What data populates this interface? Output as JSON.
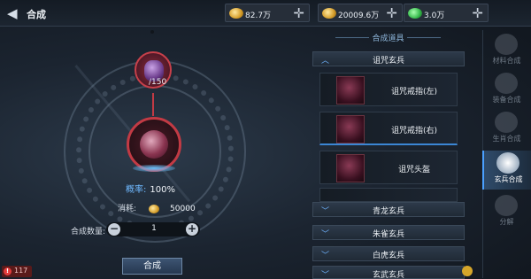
{
  "header": {
    "title": "合成",
    "currencies": [
      {
        "icon": "gold-ingot-icon",
        "value": "82.7万"
      },
      {
        "icon": "gold-ingot-icon",
        "value": "20009.6万"
      },
      {
        "icon": "jade-gem-icon",
        "value": "3.0万"
      }
    ]
  },
  "synth": {
    "material_count": "/150",
    "rate_label": "概率:",
    "rate_value": "100%",
    "cost_label": "消耗:",
    "cost_value": "50000",
    "qty_label": "合成数量:",
    "qty_value": "1",
    "combine_label": "合成"
  },
  "notification_count": "117",
  "panel": {
    "title": "合成道具",
    "expanded_category": "诅咒玄兵",
    "items": [
      {
        "name": "诅咒戒指(左)"
      },
      {
        "name": "诅咒戒指(右)"
      },
      {
        "name": "诅咒头盔"
      }
    ],
    "collapsed_categories": [
      "青龙玄兵",
      "朱雀玄兵",
      "白虎玄兵",
      "玄武玄兵"
    ]
  },
  "tabs": [
    {
      "label": "材料合成",
      "icon": "materials-icon",
      "active": false
    },
    {
      "label": "装备合成",
      "icon": "equipment-icon",
      "active": false
    },
    {
      "label": "生肖合成",
      "icon": "zodiac-icon",
      "active": false
    },
    {
      "label": "玄兵合成",
      "icon": "mystic-weapon-icon",
      "active": true
    },
    {
      "label": "分解",
      "icon": "decompose-icon",
      "active": false
    }
  ]
}
